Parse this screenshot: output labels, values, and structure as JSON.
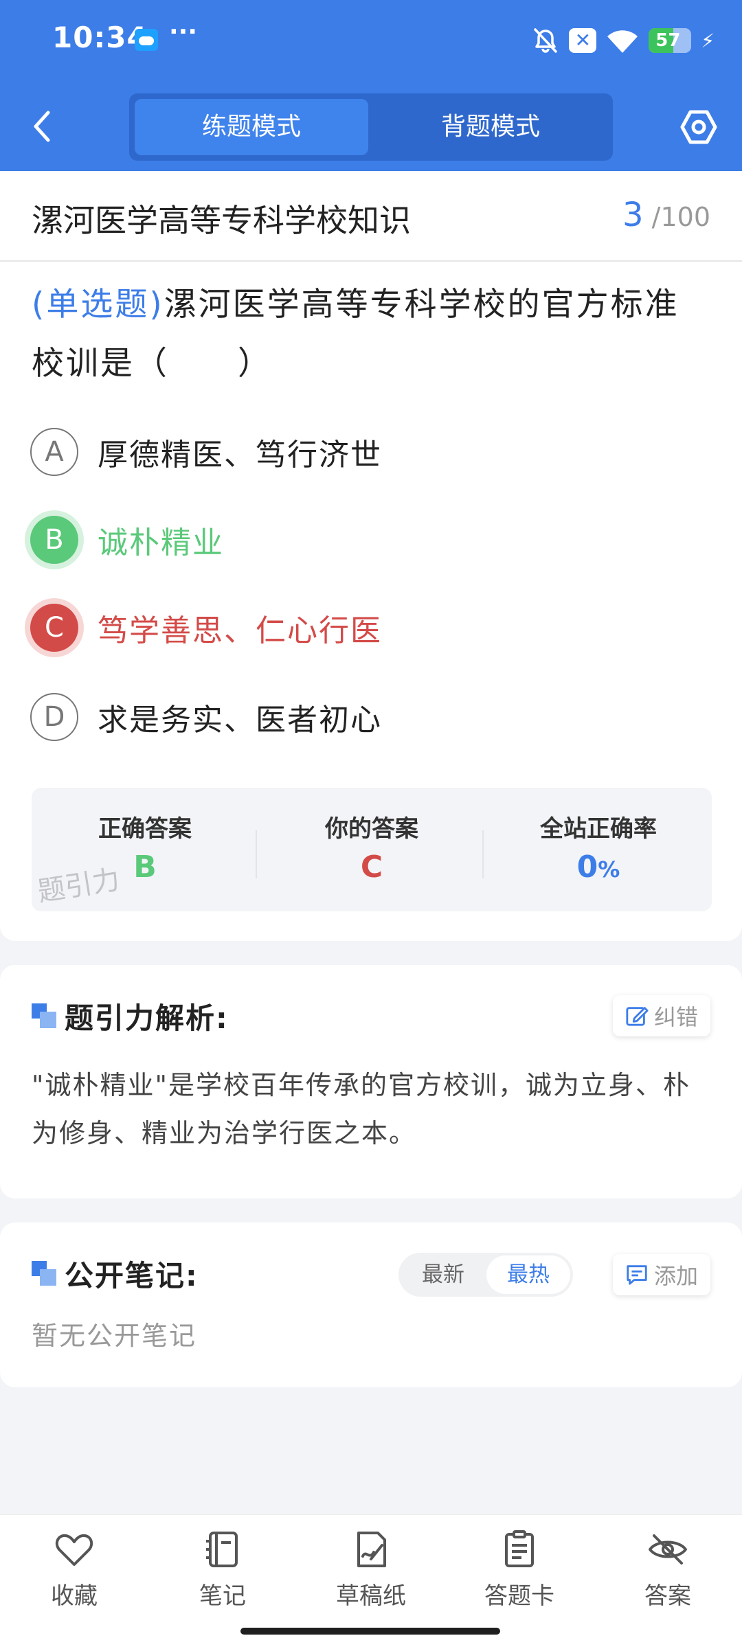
{
  "status_bar": {
    "time": "10:34",
    "overflow": "···",
    "battery": "57",
    "icons": [
      "weather-icon",
      "bell-off-icon",
      "close-box-icon",
      "wifi-icon",
      "battery-icon",
      "charging-icon"
    ]
  },
  "header": {
    "mode_active": "练题模式",
    "mode_other": "背题模式"
  },
  "quiz": {
    "bank_title": "漯河医学高等专科学校知识",
    "current": "3",
    "separator": "/",
    "total": "100",
    "type_label": "(单选题)",
    "question": "漯河医学高等专科学校的官方标准校训是（　　）",
    "options": [
      {
        "letter": "A",
        "text": "厚德精医、笃行济世",
        "state": "normal"
      },
      {
        "letter": "B",
        "text": "诚朴精业",
        "state": "correct"
      },
      {
        "letter": "C",
        "text": "笃学善思、仁心行医",
        "state": "wrong"
      },
      {
        "letter": "D",
        "text": "求是务实、医者初心",
        "state": "normal"
      }
    ],
    "answer_panel": {
      "correct_label": "正确答案",
      "correct_value": "B",
      "yours_label": "你的答案",
      "yours_value": "C",
      "rate_label": "全站正确率",
      "rate_value": "0",
      "rate_unit": "%"
    },
    "watermark": "题引力"
  },
  "analysis": {
    "title": "题引力解析:",
    "report_label": "纠错",
    "text": "\"诚朴精业\"是学校百年传承的官方校训，诚为立身、朴为修身、精业为治学行医之本。"
  },
  "notes": {
    "title": "公开笔记:",
    "sort_latest": "最新",
    "sort_hot": "最热",
    "add_label": "添加",
    "empty_text": "暂无公开笔记"
  },
  "colors": {
    "brand": "#3d7de8",
    "correct": "#5ac97a",
    "wrong": "#d34b48"
  },
  "bottom_nav": [
    {
      "label": "收藏",
      "icon": "heart-icon"
    },
    {
      "label": "笔记",
      "icon": "notebook-icon"
    },
    {
      "label": "草稿纸",
      "icon": "draft-paper-icon"
    },
    {
      "label": "答题卡",
      "icon": "answer-sheet-icon"
    },
    {
      "label": "答案",
      "icon": "eye-off-icon"
    }
  ]
}
